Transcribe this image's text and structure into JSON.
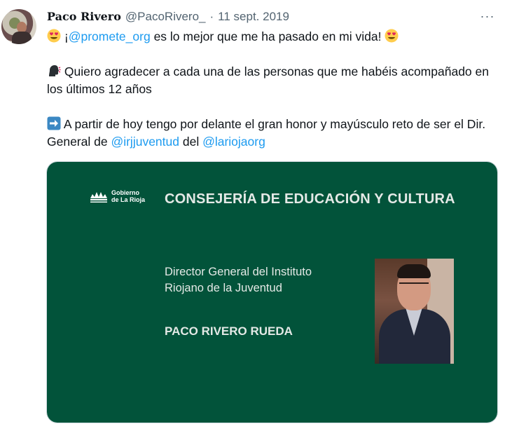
{
  "tweet": {
    "author_name": "Paco Rivero",
    "author_handle": "@PacoRivero_",
    "separator": "·",
    "date": "11 sept. 2019",
    "more_label": "···",
    "line1": {
      "emoji_left": "heart-eyes-emoji",
      "prefix": "¡",
      "mention": "@promete_org",
      "text": " es lo mejor que me ha pasado en mi vida!",
      "emoji_right": "heart-eyes-emoji"
    },
    "paragraph2": {
      "emoji": "speaking-head-emoji",
      "text": " Quiero agradecer a cada una de las personas que me habéis acompañado en los últimos 12 años"
    },
    "paragraph3": {
      "emoji": "right-arrow-emoji",
      "text": " A partir de hoy tengo por delante el gran honor y mayúsculo reto de ser el Dir. General de ",
      "mention1": "@irjjuventud",
      "middle": " del ",
      "mention2": "@lariojaorg"
    }
  },
  "media": {
    "logo_line1": "Gobierno",
    "logo_line2": "de La Rioja",
    "title": "CONSEJERÍA DE EDUCACIÓN Y CULTURA",
    "role_line1": "Director General del Instituto",
    "role_line2": "Riojano de la Juventud",
    "person": "PACO RIVERO RUEDA",
    "background_color": "#02533a"
  },
  "colors": {
    "link": "#1d9bf0",
    "text": "#0f1419",
    "muted": "#536471"
  }
}
